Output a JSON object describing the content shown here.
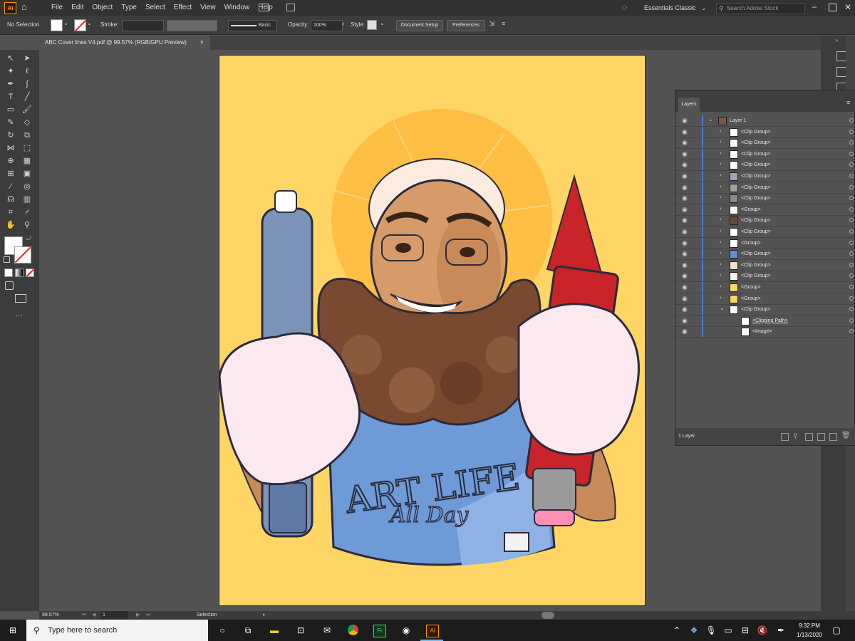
{
  "menubar": {
    "app_logo": "Ai",
    "items": [
      "File",
      "Edit",
      "Object",
      "Type",
      "Select",
      "Effect",
      "View",
      "Window",
      "Help"
    ],
    "workspace": "Essentials Classic",
    "search_placeholder": "Search Adobe Stock"
  },
  "controlbar": {
    "selection": "No Selection",
    "stroke_label": "Stroke:",
    "brush": "Basic",
    "opacity_label": "Opacity:",
    "opacity_value": "100%",
    "style_label": "Style:",
    "document_setup": "Document Setup",
    "preferences": "Preferences"
  },
  "tab": {
    "title": "ABC Cover lines V4.pdf @ 99.57% (RGB/GPU Preview)",
    "close": "×"
  },
  "artwork": {
    "shirt_text_1": "ART LIFE",
    "shirt_text_2": "All Day"
  },
  "layers": {
    "panel_title": "Layers",
    "rows": [
      {
        "label": "Layer 1",
        "indent": 0,
        "thumb": "#7a5a4a"
      },
      {
        "label": "<Clip Group>",
        "indent": 1,
        "thumb": "#ffffff"
      },
      {
        "label": "<Clip Group>",
        "indent": 1,
        "thumb": "#ffffff"
      },
      {
        "label": "<Clip Group>",
        "indent": 1,
        "thumb": "#ffffff"
      },
      {
        "label": "<Clip Group>",
        "indent": 1,
        "thumb": "#ffffff"
      },
      {
        "label": "<Clip Group>",
        "indent": 1,
        "thumb": "#9aa6b8"
      },
      {
        "label": "<Clip Group>",
        "indent": 1,
        "thumb": "#a0a0a0"
      },
      {
        "label": "<Clip Group>",
        "indent": 1,
        "thumb": "#8a8a8a"
      },
      {
        "label": "<Group>",
        "indent": 1,
        "thumb": "#ffffff"
      },
      {
        "label": "<Clip Group>",
        "indent": 1,
        "thumb": "#6b4a3a"
      },
      {
        "label": "<Clip Group>",
        "indent": 1,
        "thumb": "#ffffff"
      },
      {
        "label": "<Group>",
        "indent": 1,
        "thumb": "#ffffff"
      },
      {
        "label": "<Clip Group>",
        "indent": 1,
        "thumb": "#6a8ac8"
      },
      {
        "label": "<Clip Group>",
        "indent": 1,
        "thumb": "#f4e0d0"
      },
      {
        "label": "<Clip Group>",
        "indent": 1,
        "thumb": "#fff0e8"
      },
      {
        "label": "<Group>",
        "indent": 1,
        "thumb": "#ffd565"
      },
      {
        "label": "<Group>",
        "indent": 1,
        "thumb": "#ffd565"
      },
      {
        "label": "<Clip Group>",
        "indent": 1,
        "thumb": "#ffffff"
      },
      {
        "label": "<Clipping Path>",
        "indent": 2,
        "thumb": "#ffffff"
      },
      {
        "label": "<Image>",
        "indent": 2,
        "thumb": "#ffffff"
      }
    ],
    "footer": "1 Layer"
  },
  "statusbar": {
    "zoom": "99.57%",
    "page": "1",
    "tool": "Selection"
  },
  "taskbar": {
    "search_placeholder": "Type here to search",
    "time": "9:32 PM",
    "date": "1/13/2020"
  },
  "colors": {
    "artboard": "#ffd565",
    "halo": "#ffbf45",
    "shirt": "#6f9ad8",
    "accent": "#ff9a00"
  }
}
